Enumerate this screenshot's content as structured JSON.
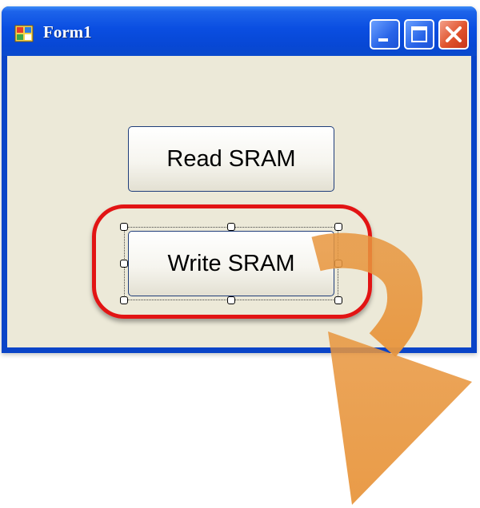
{
  "window": {
    "title": "Form1",
    "controls": {
      "minimize": "minimize",
      "maximize": "maximize",
      "close": "close"
    }
  },
  "form": {
    "read_button": "Read SRAM",
    "write_button": "Write SRAM"
  },
  "annotations": {
    "highlight_color": "#e21414",
    "arrow_color": "#e8963e"
  }
}
